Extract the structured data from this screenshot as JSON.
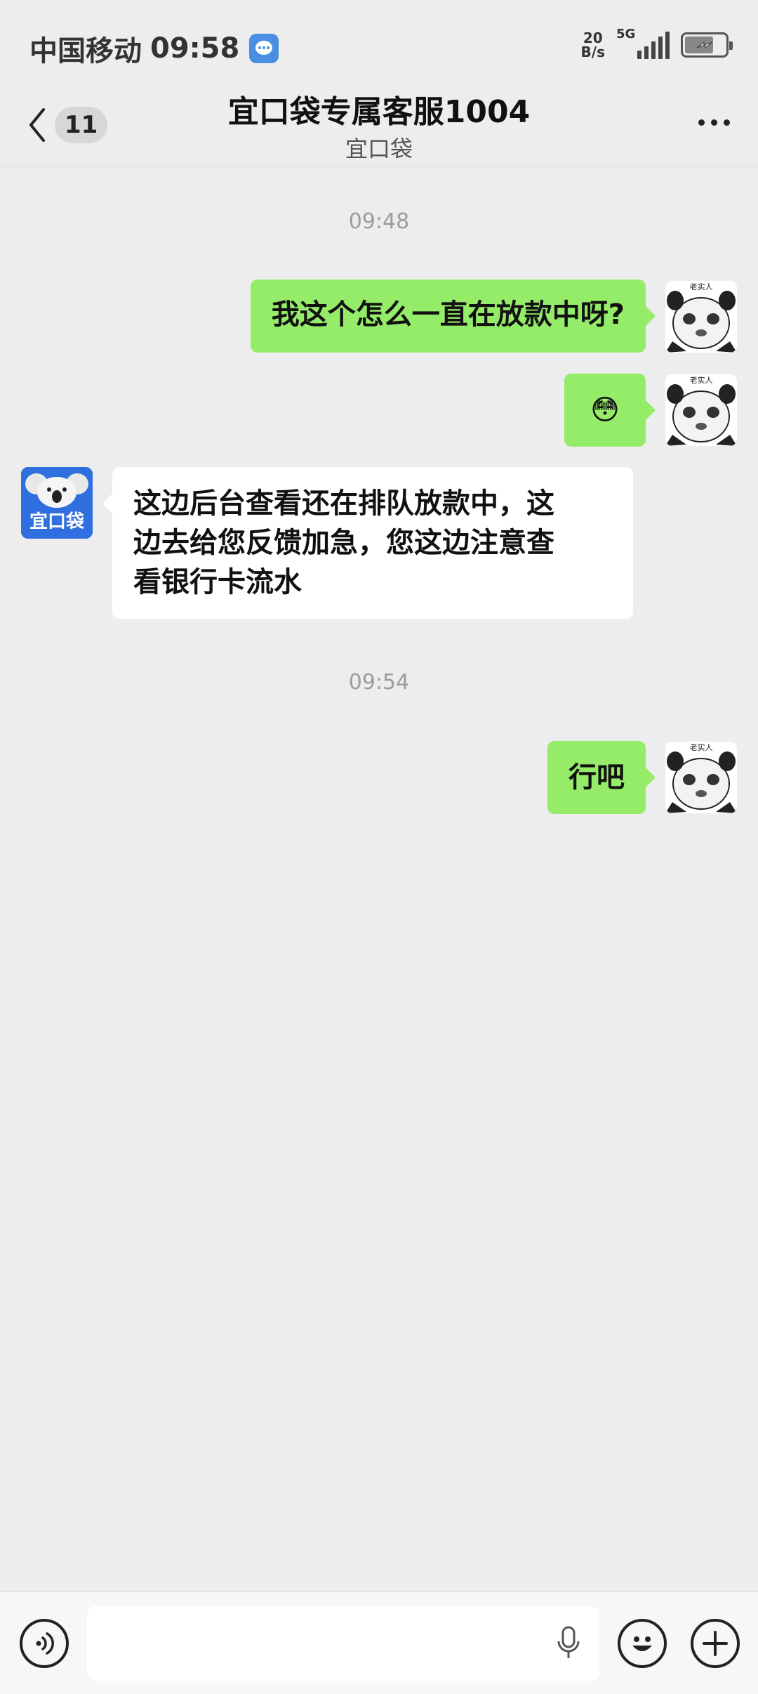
{
  "status_bar": {
    "carrier": "中国移动",
    "time": "09:58",
    "net_speed_value": "20",
    "net_speed_unit": "B/s",
    "network": "5G"
  },
  "header": {
    "back_badge": "11",
    "title": "宜口袋专属客服1004",
    "subtitle": "宜口袋"
  },
  "chat": {
    "timestamps": [
      "09:48",
      "09:54"
    ],
    "messages": [
      {
        "side": "out",
        "text": "我这个怎么一直在放款中呀?"
      },
      {
        "side": "out",
        "type": "emoji",
        "emoji": "😳"
      },
      {
        "side": "in",
        "line1": "这边后台查看还在排队放款中，这",
        "line2": "边去给您反馈加急，您这边注意查",
        "line3": "看银行卡流水"
      },
      {
        "side": "out",
        "text": "行吧"
      }
    ],
    "avatar_app_label": "宜口袋",
    "avatar_panda_label": "老实人"
  },
  "colors": {
    "outgoing_bubble": "#95ec69",
    "incoming_bubble": "#ffffff",
    "background": "#ededed"
  }
}
